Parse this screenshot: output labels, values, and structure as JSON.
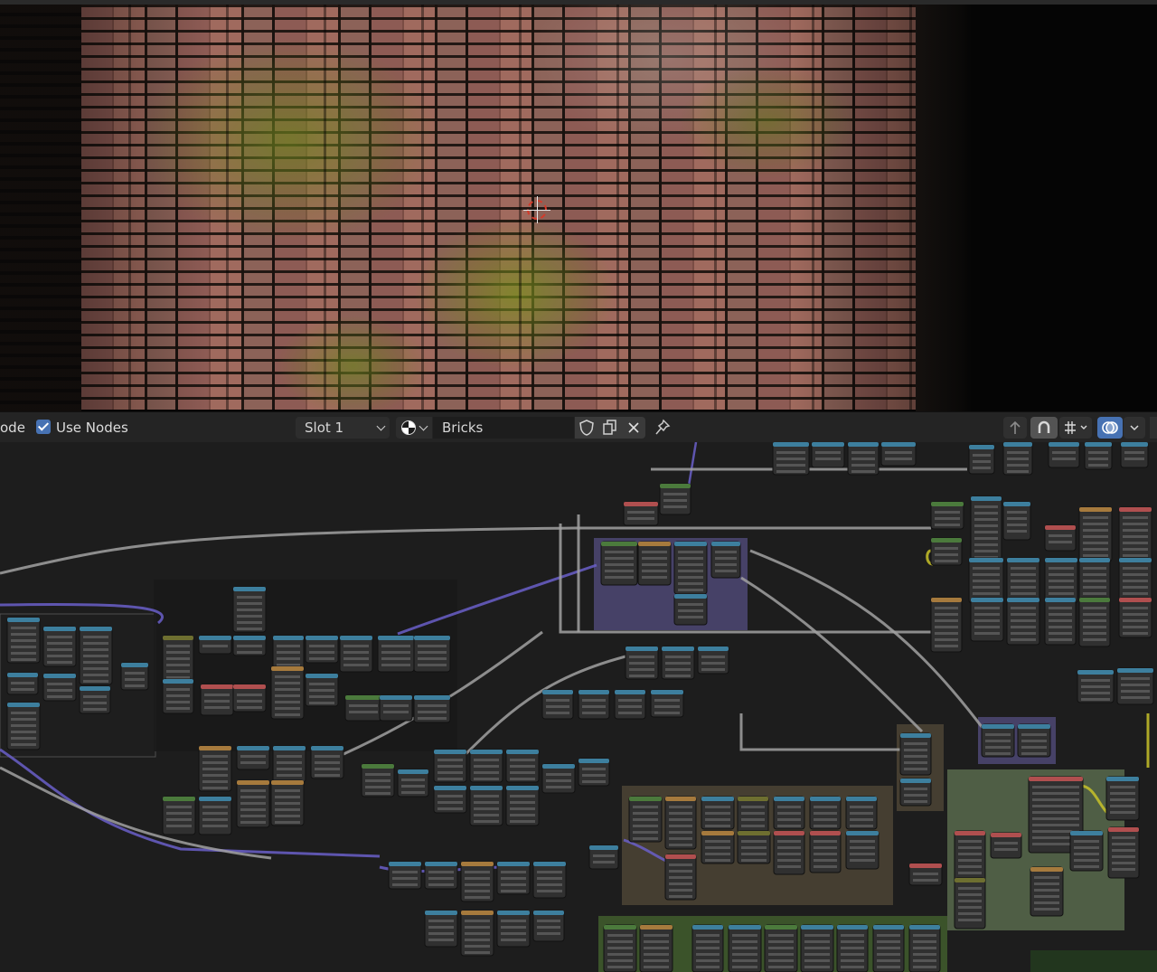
{
  "viewport": {
    "view": "3D viewport showing a moss-covered red brick wall render",
    "cursor_icon": "3d-cursor-icon"
  },
  "header": {
    "mode_label_fragment": "ode",
    "use_nodes": {
      "label": "Use Nodes",
      "checked": true,
      "icon": "checkbox-checked-icon"
    },
    "slot": {
      "value": "Slot 1",
      "icon": "chevron-down-icon"
    },
    "material": {
      "browse_icon": "material-sphere-icon",
      "name": "Bricks",
      "fake_user_icon": "shield-icon",
      "duplicate_icon": "duplicate-icon",
      "unlink_icon": "close-icon"
    },
    "pin_icon": "pin-icon",
    "right_tools": {
      "parent_icon": "arrow-up-icon",
      "snap_toggle_icon": "magnet-icon",
      "snap_grid_icon": "grid-snap-icon",
      "overlay_icon": "overlay-icon"
    },
    "colors": {
      "accent": "#4772b3",
      "header_bg": "#242424"
    }
  },
  "node_editor": {
    "frame_colors": {
      "purple_frame": "#4b4670",
      "brown_frame": "#4a4234",
      "green_frame": "#55664a",
      "dark_frame": "#1a1a1a"
    },
    "node_header_colors": [
      "#3d7f9e",
      "#b04f4f",
      "#a67a3d",
      "#4b7a3c",
      "#6e6f30",
      "#5a4d8a"
    ],
    "link_colors": {
      "vector": "#6a5fc9",
      "float": "#a1a1a1",
      "color": "#c8c229"
    }
  }
}
